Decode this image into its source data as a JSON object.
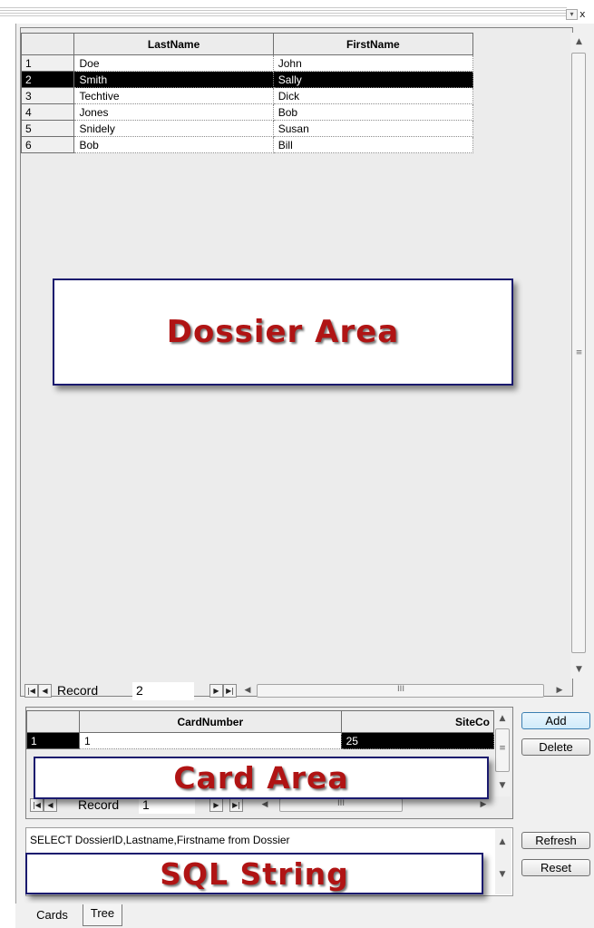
{
  "window": {
    "dropdown_glyph": "▾",
    "close_glyph": "x"
  },
  "dossier_grid": {
    "columns": [
      "LastName",
      "FirstName"
    ],
    "rows": [
      {
        "num": "1",
        "last": "Doe",
        "first": "John"
      },
      {
        "num": "2",
        "last": "Smith",
        "first": "Sally",
        "selected": true
      },
      {
        "num": "3",
        "last": "Techtive",
        "first": "Dick"
      },
      {
        "num": "4",
        "last": "Jones",
        "first": "Bob"
      },
      {
        "num": "5",
        "last": "Snidely",
        "first": "Susan"
      },
      {
        "num": "6",
        "last": "Bob",
        "first": "Bill"
      }
    ],
    "navigator": {
      "label": "Record",
      "value": "2"
    }
  },
  "card_grid": {
    "columns": [
      "CardNumber",
      "SiteCo"
    ],
    "rows": [
      {
        "num": "1",
        "card_number": "1",
        "site_code": "25"
      }
    ],
    "navigator": {
      "label": "Record",
      "value": "1"
    }
  },
  "sql": {
    "text": "SELECT DossierID,Lastname,Firstname from Dossier"
  },
  "buttons": {
    "add": "Add",
    "delete": "Delete",
    "refresh": "Refresh",
    "reset": "Reset"
  },
  "overlays": {
    "dossier_area": "Dossier Area",
    "card_area": "Card Area",
    "sql_string": "SQL String"
  },
  "tabs": [
    {
      "label": "Cards",
      "active": true
    },
    {
      "label": "Tree",
      "active": false
    }
  ],
  "colors": {
    "overlay_text": "#b01414",
    "overlay_border": "#1a1a6e",
    "selection": "#000000"
  }
}
